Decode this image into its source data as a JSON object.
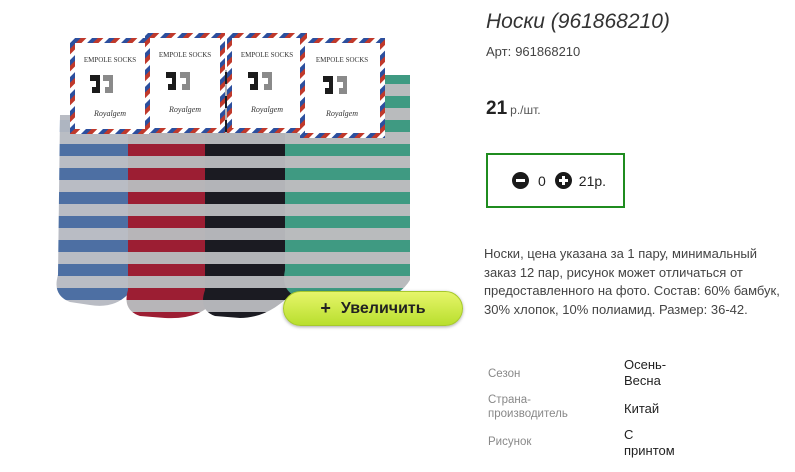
{
  "product": {
    "title": "Носки (961868210)",
    "sku_label": "Арт:",
    "sku_value": "961868210",
    "price_value": "21",
    "price_unit": "р./шт.",
    "description": "Носки, цена указана за 1 пару, минимальный заказ 12 пар, рисунок может отличаться от предоставленного на фото. Состав: 60% бамбук, 30% хлопок, 10% полиамид. Размер: 36-42."
  },
  "image": {
    "zoom_label": "Увеличить",
    "tag_brand": "EMPOLE SOCKS",
    "tag_maker": "Royalgem"
  },
  "cart": {
    "quantity": "0",
    "sum": "21р."
  },
  "properties": [
    {
      "key": "Сезон",
      "value": "Осень-Весна"
    },
    {
      "key": "Страна-производитель",
      "value": "Китай"
    },
    {
      "key": "Рисунок",
      "value": "С принтом"
    }
  ],
  "colors": {
    "accent_green": "#1f8c1f",
    "zoom_button": "#c9e83f",
    "sock_blue": "#4d6fa3",
    "sock_red": "#9c1e33",
    "sock_black": "#1b1b22",
    "sock_teal": "#3f9a82",
    "stripe_gray": "#b8b8bc"
  }
}
